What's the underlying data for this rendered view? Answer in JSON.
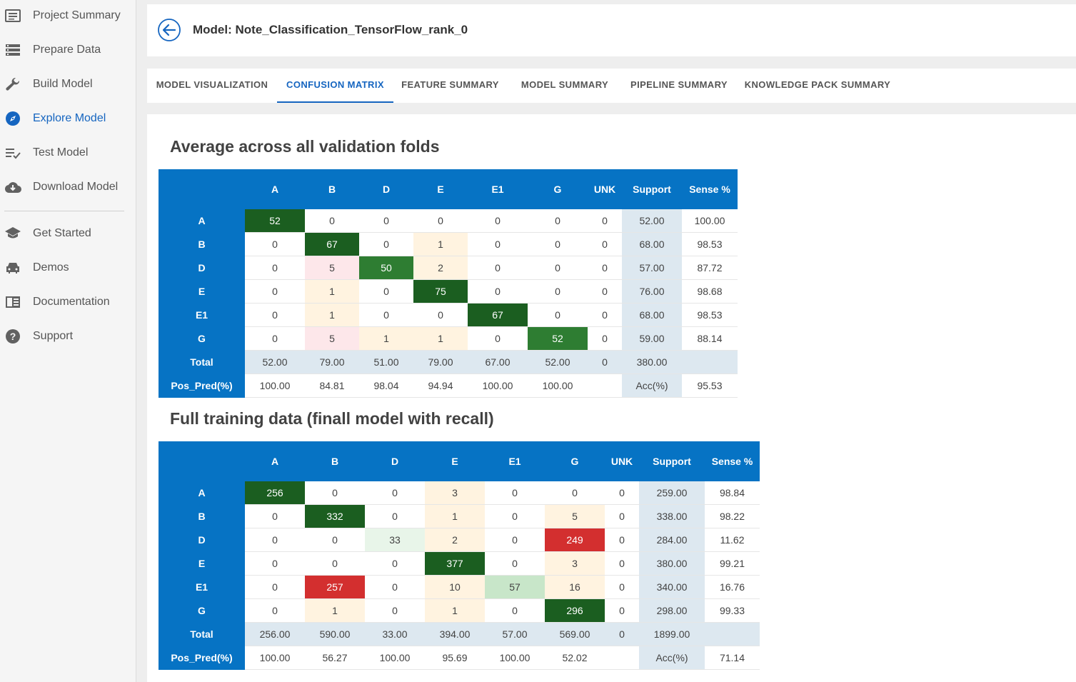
{
  "sidebar": {
    "items": [
      {
        "label": "Project Summary",
        "icon": "summary-icon",
        "active": false
      },
      {
        "label": "Prepare Data",
        "icon": "storage-icon",
        "active": false
      },
      {
        "label": "Build Model",
        "icon": "wrench-icon",
        "active": false
      },
      {
        "label": "Explore Model",
        "icon": "compass-icon",
        "active": true
      },
      {
        "label": "Test Model",
        "icon": "playlist-check-icon",
        "active": false
      },
      {
        "label": "Download Model",
        "icon": "cloud-download-icon",
        "active": false
      }
    ],
    "secondary_items": [
      {
        "label": "Get Started",
        "icon": "school-icon"
      },
      {
        "label": "Demos",
        "icon": "car-icon"
      },
      {
        "label": "Documentation",
        "icon": "book-icon"
      },
      {
        "label": "Support",
        "icon": "help-icon"
      }
    ]
  },
  "header": {
    "title": "Model: Note_Classification_TensorFlow_rank_0"
  },
  "tabs": [
    {
      "label": "MODEL VISUALIZATION",
      "active": false
    },
    {
      "label": "CONFUSION MATRIX",
      "active": true
    },
    {
      "label": "FEATURE SUMMARY",
      "active": false
    },
    {
      "label": "MODEL SUMMARY",
      "active": false
    },
    {
      "label": "PIPELINE SUMMARY",
      "active": false
    },
    {
      "label": "KNOWLEDGE PACK SUMMARY",
      "active": false
    }
  ],
  "colors": {
    "accent": "#1565c0",
    "table_header": "#0673c4",
    "dark_green": "#1b5e20",
    "medium_green": "#2e7d32",
    "light_green": "#c8e6c9",
    "peach": "#fff3e0",
    "pink": "#fde7ea",
    "red": "#d32f2f",
    "support_bg": "#dde8f0"
  },
  "matrices": [
    {
      "title": "Average across all validation folds",
      "columns": [
        "A",
        "B",
        "D",
        "E",
        "E1",
        "G",
        "UNK",
        "Support",
        "Sense %"
      ],
      "rows": [
        {
          "label": "A",
          "cells": [
            [
              "52",
              "dg"
            ],
            [
              "0",
              ""
            ],
            [
              "0",
              ""
            ],
            [
              "0",
              ""
            ],
            [
              "0",
              ""
            ],
            [
              "0",
              ""
            ],
            [
              "0",
              ""
            ]
          ],
          "support": "52.00",
          "sense": "100.00"
        },
        {
          "label": "B",
          "cells": [
            [
              "0",
              ""
            ],
            [
              "67",
              "dg"
            ],
            [
              "0",
              ""
            ],
            [
              "1",
              "peach"
            ],
            [
              "0",
              ""
            ],
            [
              "0",
              ""
            ],
            [
              "0",
              ""
            ]
          ],
          "support": "68.00",
          "sense": "98.53"
        },
        {
          "label": "D",
          "cells": [
            [
              "0",
              ""
            ],
            [
              "5",
              "pink"
            ],
            [
              "50",
              "mg"
            ],
            [
              "2",
              "peach"
            ],
            [
              "0",
              ""
            ],
            [
              "0",
              ""
            ],
            [
              "0",
              ""
            ]
          ],
          "support": "57.00",
          "sense": "87.72"
        },
        {
          "label": "E",
          "cells": [
            [
              "0",
              ""
            ],
            [
              "1",
              "peach"
            ],
            [
              "0",
              ""
            ],
            [
              "75",
              "dg"
            ],
            [
              "0",
              ""
            ],
            [
              "0",
              ""
            ],
            [
              "0",
              ""
            ]
          ],
          "support": "76.00",
          "sense": "98.68"
        },
        {
          "label": "E1",
          "cells": [
            [
              "0",
              ""
            ],
            [
              "1",
              "peach"
            ],
            [
              "0",
              ""
            ],
            [
              "0",
              ""
            ],
            [
              "67",
              "dg"
            ],
            [
              "0",
              ""
            ],
            [
              "0",
              ""
            ]
          ],
          "support": "68.00",
          "sense": "98.53"
        },
        {
          "label": "G",
          "cells": [
            [
              "0",
              ""
            ],
            [
              "5",
              "pink"
            ],
            [
              "1",
              "peach"
            ],
            [
              "1",
              "peach"
            ],
            [
              "0",
              ""
            ],
            [
              "52",
              "mg"
            ],
            [
              "0",
              ""
            ]
          ],
          "support": "59.00",
          "sense": "88.14"
        }
      ],
      "total": {
        "label": "Total",
        "values": [
          "52.00",
          "79.00",
          "51.00",
          "79.00",
          "67.00",
          "52.00",
          "0"
        ],
        "support": "380.00",
        "sense": ""
      },
      "pos_pred": {
        "label": "Pos_Pred(%)",
        "values": [
          "100.00",
          "84.81",
          "98.04",
          "94.94",
          "100.00",
          "100.00",
          ""
        ],
        "support": "Acc(%)",
        "sense": "95.53"
      }
    },
    {
      "title": "Full training data (finall model with recall)",
      "columns": [
        "A",
        "B",
        "D",
        "E",
        "E1",
        "G",
        "UNK",
        "Support",
        "Sense %"
      ],
      "rows": [
        {
          "label": "A",
          "cells": [
            [
              "256",
              "dg"
            ],
            [
              "0",
              ""
            ],
            [
              "0",
              ""
            ],
            [
              "3",
              "peach"
            ],
            [
              "0",
              ""
            ],
            [
              "0",
              ""
            ],
            [
              "0",
              ""
            ]
          ],
          "support": "259.00",
          "sense": "98.84"
        },
        {
          "label": "B",
          "cells": [
            [
              "0",
              ""
            ],
            [
              "332",
              "dg"
            ],
            [
              "0",
              ""
            ],
            [
              "1",
              "peach"
            ],
            [
              "0",
              ""
            ],
            [
              "5",
              "peach"
            ],
            [
              "0",
              ""
            ]
          ],
          "support": "338.00",
          "sense": "98.22"
        },
        {
          "label": "D",
          "cells": [
            [
              "0",
              ""
            ],
            [
              "0",
              ""
            ],
            [
              "33",
              "vlg"
            ],
            [
              "2",
              "peach"
            ],
            [
              "0",
              ""
            ],
            [
              "249",
              "red"
            ],
            [
              "0",
              ""
            ]
          ],
          "support": "284.00",
          "sense": "11.62"
        },
        {
          "label": "E",
          "cells": [
            [
              "0",
              ""
            ],
            [
              "0",
              ""
            ],
            [
              "0",
              ""
            ],
            [
              "377",
              "dg"
            ],
            [
              "0",
              ""
            ],
            [
              "3",
              "peach"
            ],
            [
              "0",
              ""
            ]
          ],
          "support": "380.00",
          "sense": "99.21"
        },
        {
          "label": "E1",
          "cells": [
            [
              "0",
              ""
            ],
            [
              "257",
              "red"
            ],
            [
              "0",
              ""
            ],
            [
              "10",
              "peach"
            ],
            [
              "57",
              "lg"
            ],
            [
              "16",
              "peach"
            ],
            [
              "0",
              ""
            ]
          ],
          "support": "340.00",
          "sense": "16.76"
        },
        {
          "label": "G",
          "cells": [
            [
              "0",
              ""
            ],
            [
              "1",
              "peach"
            ],
            [
              "0",
              ""
            ],
            [
              "1",
              "peach"
            ],
            [
              "0",
              ""
            ],
            [
              "296",
              "dg"
            ],
            [
              "0",
              ""
            ]
          ],
          "support": "298.00",
          "sense": "99.33"
        }
      ],
      "total": {
        "label": "Total",
        "values": [
          "256.00",
          "590.00",
          "33.00",
          "394.00",
          "57.00",
          "569.00",
          "0"
        ],
        "support": "1899.00",
        "sense": ""
      },
      "pos_pred": {
        "label": "Pos_Pred(%)",
        "values": [
          "100.00",
          "56.27",
          "100.00",
          "95.69",
          "100.00",
          "52.02",
          ""
        ],
        "support": "Acc(%)",
        "sense": "71.14"
      }
    }
  ]
}
